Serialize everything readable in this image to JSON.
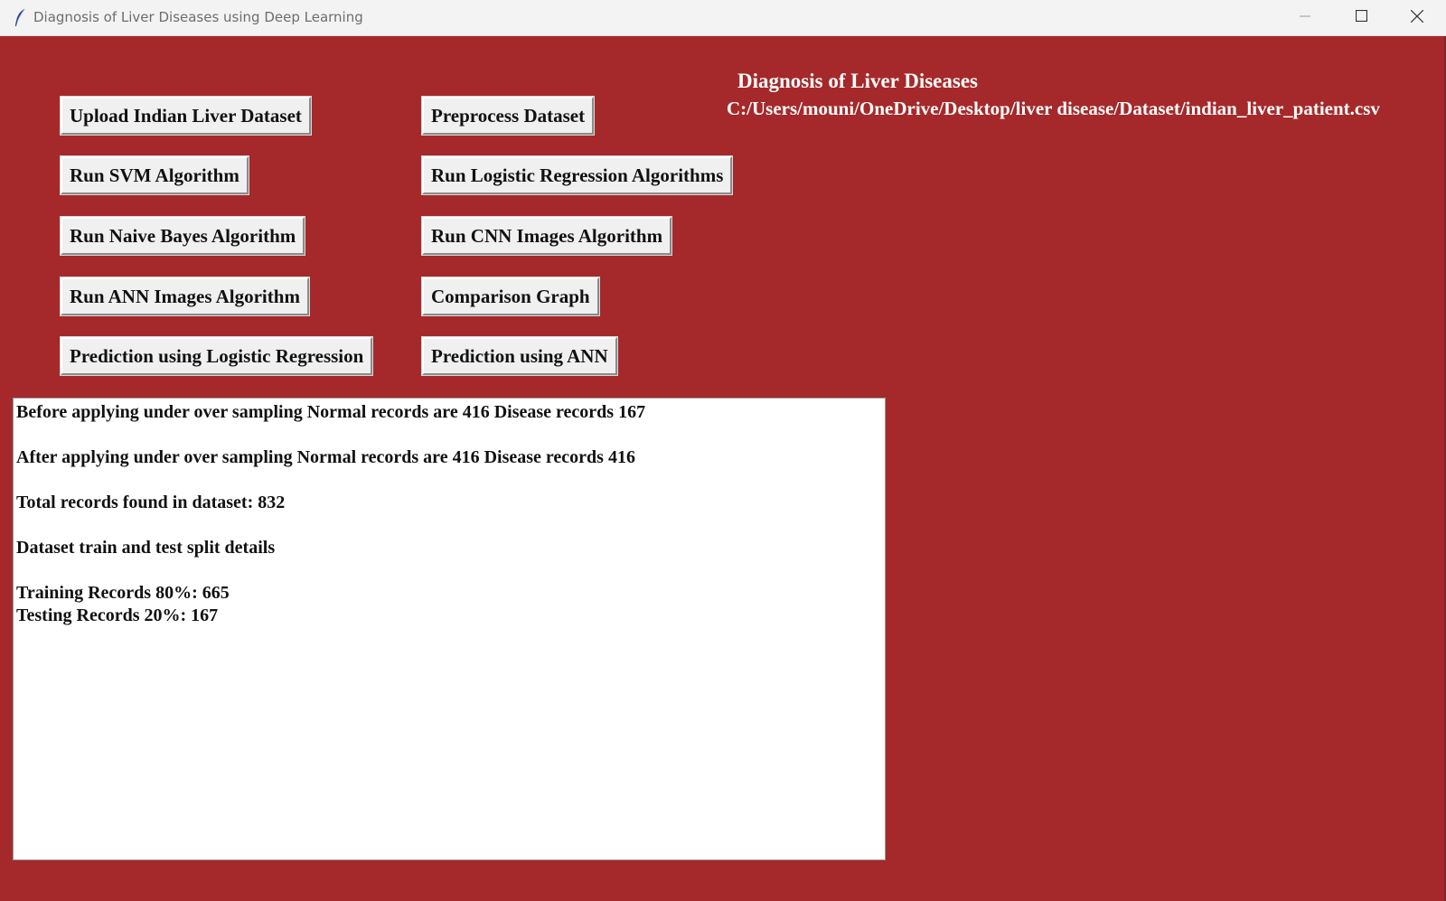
{
  "window": {
    "title": "Diagnosis of Liver Diseases using Deep Learning",
    "colors": {
      "background": "#a5292a",
      "text_header": "#ffffff",
      "button_face": "#f0f0f0",
      "output_background": "#ffffff"
    },
    "icons": {
      "app": "feather-icon",
      "minimize": "minimize-icon",
      "maximize": "maximize-icon",
      "close": "close-icon"
    }
  },
  "header": {
    "title": "Diagnosis of Liver Diseases",
    "path": "C:/Users/mouni/OneDrive/Desktop/liver disease/Dataset/indian_liver_patient.csv"
  },
  "buttons": {
    "upload": "Upload Indian Liver Dataset",
    "preprocess": "Preprocess Dataset",
    "svm": "Run SVM Algorithm",
    "logistic": "Run Logistic Regression Algorithms",
    "naive_bayes": "Run Naive Bayes Algorithm",
    "cnn": "Run CNN Images Algorithm",
    "ann": "Run ANN Images Algorithm",
    "comparison": "Comparison Graph",
    "predict_lr": "Prediction using Logistic Regression",
    "predict_ann": "Prediction using ANN"
  },
  "output": {
    "lines": [
      "Before applying under over sampling Normal records are 416 Disease records 167",
      "After applying under over sampling Normal records are 416 Disease records 416",
      "Total records found in dataset: 832",
      "Dataset train and test split details",
      "Training Records 80%: 665",
      "Testing Records 20%: 167"
    ]
  }
}
